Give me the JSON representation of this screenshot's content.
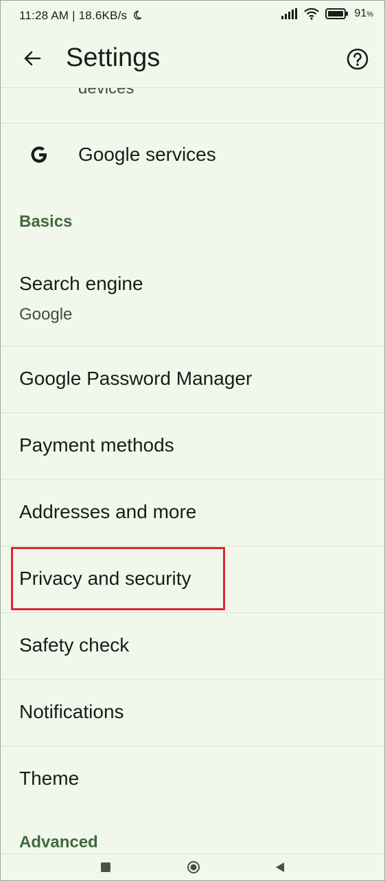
{
  "status_bar": {
    "time_speed": "11:28 AM | 18.6KB/s",
    "battery": "91"
  },
  "app_bar": {
    "title": "Settings"
  },
  "list": {
    "partial_item": "devices",
    "google_services": "Google services",
    "basics_header": "Basics",
    "search_engine": {
      "label": "Search engine",
      "value": "Google"
    },
    "password_manager": "Google Password Manager",
    "payment_methods": "Payment methods",
    "addresses": "Addresses and more",
    "privacy": "Privacy and security",
    "safety_check": "Safety check",
    "notifications": "Notifications",
    "theme": "Theme",
    "advanced_header": "Advanced"
  },
  "colors": {
    "background": "#f2f7ec",
    "section_header": "#3f6a3c",
    "highlight_box": "#e0252c"
  },
  "icons": [
    "back-arrow-icon",
    "help-icon",
    "google-g-icon",
    "signal-icon",
    "wifi-icon",
    "battery-icon",
    "moon-icon",
    "recents-icon",
    "home-icon",
    "back-nav-icon"
  ]
}
